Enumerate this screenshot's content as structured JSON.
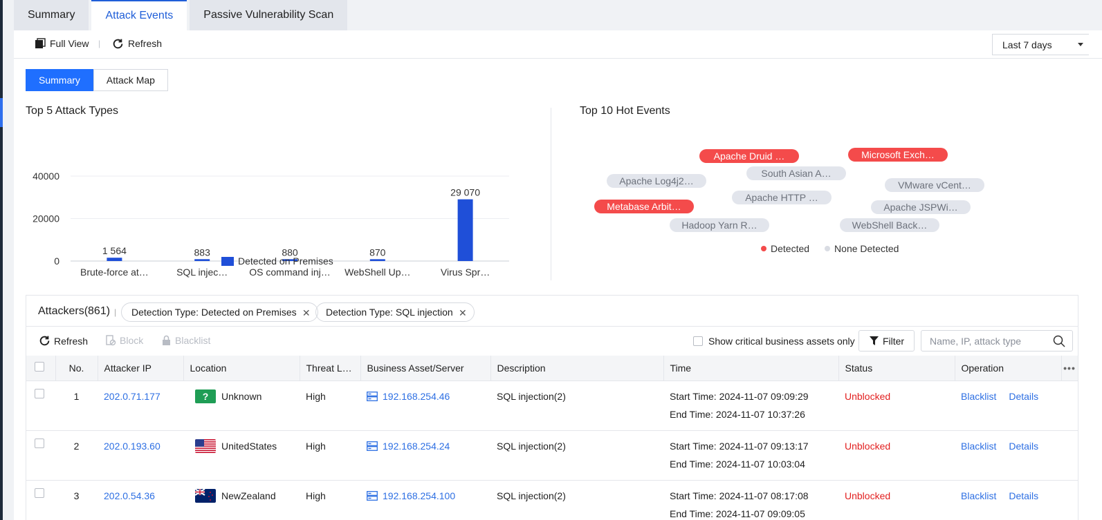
{
  "tabs": [
    {
      "label": "Summary",
      "active": false
    },
    {
      "label": "Attack Events",
      "active": true
    },
    {
      "label": "Passive Vulnerability Scan",
      "active": false
    }
  ],
  "toolbar": {
    "full_view": "Full View",
    "refresh": "Refresh",
    "range_selected": "Last 7 days"
  },
  "view_toggle": {
    "summary": "Summary",
    "attack_map": "Attack Map",
    "active": "summary"
  },
  "attack_types": {
    "title": "Top 5 Attack Types",
    "chart_data": {
      "type": "bar",
      "categories": [
        "Brute-force at…",
        "SQL injec…",
        "OS command inj…",
        "WebShell Up…",
        "Virus Spr…"
      ],
      "series": [
        {
          "name": "Detected on Premises",
          "values": [
            1564,
            883,
            880,
            870,
            29070
          ]
        }
      ],
      "value_labels": [
        "1 564",
        "883",
        "880",
        "870",
        "29 070"
      ],
      "yticks": [
        "40000",
        "20000",
        "0"
      ],
      "ylim": [
        0,
        40000
      ],
      "bar_color": "#1f4fd8",
      "grid": true,
      "legend": "bottom"
    }
  },
  "hot_events": {
    "title": "Top 10 Hot Events",
    "events": [
      {
        "label": "Apache Druid …",
        "status": "detected"
      },
      {
        "label": "Microsoft Exch…",
        "status": "detected"
      },
      {
        "label": "South Asian A…",
        "status": "none"
      },
      {
        "label": "Apache Log4j2…",
        "status": "none"
      },
      {
        "label": "VMware vCent…",
        "status": "none"
      },
      {
        "label": "Apache HTTP …",
        "status": "none"
      },
      {
        "label": "Metabase Arbit…",
        "status": "detected"
      },
      {
        "label": "Apache JSPWi…",
        "status": "none"
      },
      {
        "label": "Hadoop Yarn R…",
        "status": "none"
      },
      {
        "label": "WebShell Back…",
        "status": "none"
      }
    ],
    "legend_detected": "Detected",
    "legend_none": "None Detected",
    "color_detected": "#f44b4b",
    "color_none": "#e2e5ec"
  },
  "attackers": {
    "title": "Attackers(861)",
    "chips": [
      "Detection Type: Detected on Premises",
      "Detection Type: SQL injection"
    ],
    "tools": {
      "refresh": "Refresh",
      "block": "Block",
      "blacklist": "Blacklist"
    },
    "critical_only": "Show critical business assets only",
    "filter": "Filter",
    "search_placeholder": "Name, IP, attack type",
    "columns": [
      "No.",
      "Attacker IP",
      "Location",
      "Threat L…",
      "Business Asset/Server",
      "Description",
      "Time",
      "Status",
      "Operation"
    ],
    "more_icon": "more-icon",
    "rows": [
      {
        "no": "1",
        "ip": "202.0.71.177",
        "location": "Unknown",
        "flag": "unknown",
        "threat": "High",
        "asset": "192.168.254.46",
        "description": "SQL injection(2)",
        "start": "Start Time: 2024-11-07 09:09:29",
        "end": "End Time: 2024-11-07 10:37:26",
        "status": "Unblocked",
        "op1": "Blacklist",
        "op2": "Details"
      },
      {
        "no": "2",
        "ip": "202.0.193.60",
        "location": "UnitedStates",
        "flag": "us",
        "threat": "High",
        "asset": "192.168.254.24",
        "description": "SQL injection(2)",
        "start": "Start Time: 2024-11-07 09:13:17",
        "end": "End Time: 2024-11-07 10:03:04",
        "status": "Unblocked",
        "op1": "Blacklist",
        "op2": "Details"
      },
      {
        "no": "3",
        "ip": "202.0.54.36",
        "location": "NewZealand",
        "flag": "nz",
        "threat": "High",
        "asset": "192.168.254.100",
        "description": "SQL injection(2)",
        "start": "Start Time: 2024-11-07 08:17:08",
        "end": "End Time: 2024-11-07 09:09:05",
        "status": "Unblocked",
        "op1": "Blacklist",
        "op2": "Details"
      }
    ]
  }
}
